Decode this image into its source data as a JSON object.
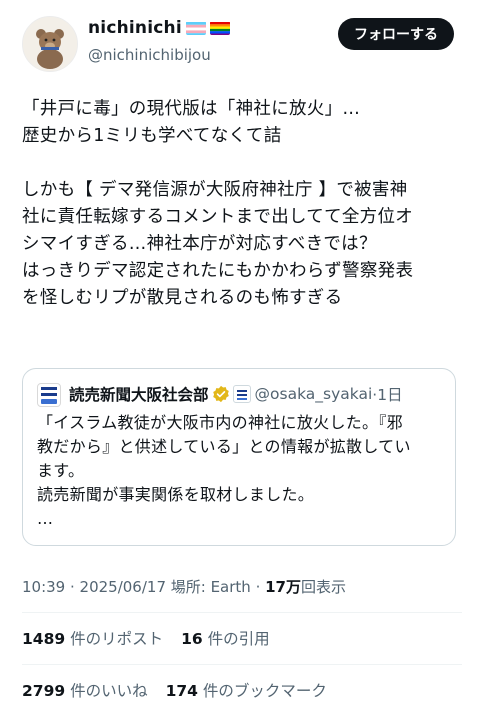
{
  "author": {
    "display_name": "nichinichi",
    "handle": "@nichinichibijou",
    "avatar_icon": "bear-avatar-icon",
    "name_flags": [
      "transgender-flag-icon",
      "rainbow-flag-icon"
    ]
  },
  "follow_label": "フォローする",
  "tweet_text": "「井戸に毒」の現代版は「神社に放火」…\n歴史から1ミリも学べてなくて詰\n\nしかも【 デマ発信源が大阪府神社庁 】で被害神\n社に責任転嫁するコメントまで出してて全方位オ\nシマイすぎる…神社本庁が対応すべきでは？\nはっきりデマ認定されたにもかかわらず警察発表\nを怪しむリプが散見されるのも怖すぎる",
  "quote": {
    "name": "読売新聞大阪社会部",
    "handle": "@osaka_syakai",
    "time": "·1日",
    "verified_color": "#e2b719",
    "text": "「イスラム教徒が大阪市内の神社に放火した。『邪\n教だから』と供述している」との情報が拡散してい\nます。\n読売新聞が事実関係を取材しました。\n…"
  },
  "meta": {
    "time": "10:39 · 2025/06/17 場所: Earth · ",
    "views_count": "17万",
    "views_label": "回表示"
  },
  "stats": {
    "reposts_count": "1489",
    "reposts_label": "件のリポスト",
    "quotes_count": "16",
    "quotes_label": "件の引用",
    "likes_count": "2799",
    "likes_label": "件のいいね",
    "bookmarks_count": "174",
    "bookmarks_label": "件のブックマーク"
  }
}
